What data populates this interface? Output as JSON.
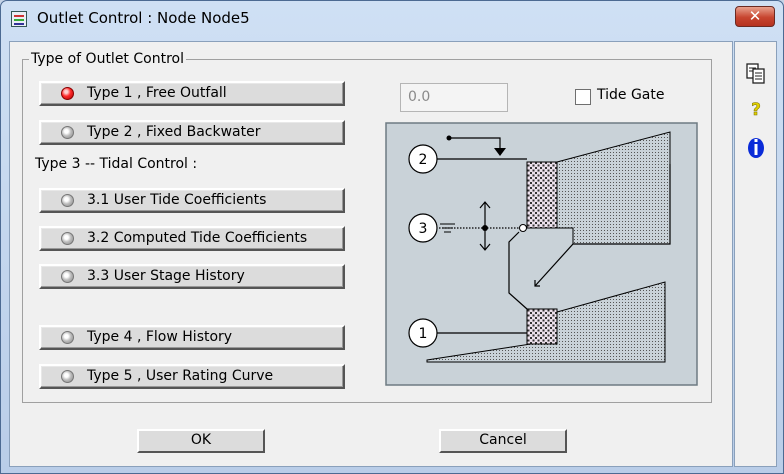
{
  "window": {
    "title": "Outlet Control : Node Node5",
    "close_glyph": "✕"
  },
  "group": {
    "legend": "Type of Outlet Control"
  },
  "options": {
    "type1": "Type 1 , Free Outfall",
    "type2": "Type 2 , Fixed Backwater",
    "type3_heading": "Type 3 -- Tidal Control :",
    "type31": "3.1 User Tide Coefficients",
    "type32": "3.2 Computed Tide Coefficients",
    "type33": "3.3 User Stage History",
    "type4": "Type 4 , Flow History",
    "type5": "Type 5 , User Rating Curve",
    "selected": "type1"
  },
  "fixed_value": {
    "value": "0.0"
  },
  "tide_gate": {
    "label": "Tide Gate",
    "checked": false
  },
  "diagram": {
    "labels": [
      "1",
      "2",
      "3"
    ]
  },
  "buttons": {
    "ok": "OK",
    "cancel": "Cancel"
  },
  "side_icons": [
    "copy-icon",
    "help-icon",
    "info-icon"
  ],
  "colors": {
    "accent_selected": "#ff2020",
    "close_red": "#c7452f",
    "diagram_bg": "#c9d2d8"
  }
}
